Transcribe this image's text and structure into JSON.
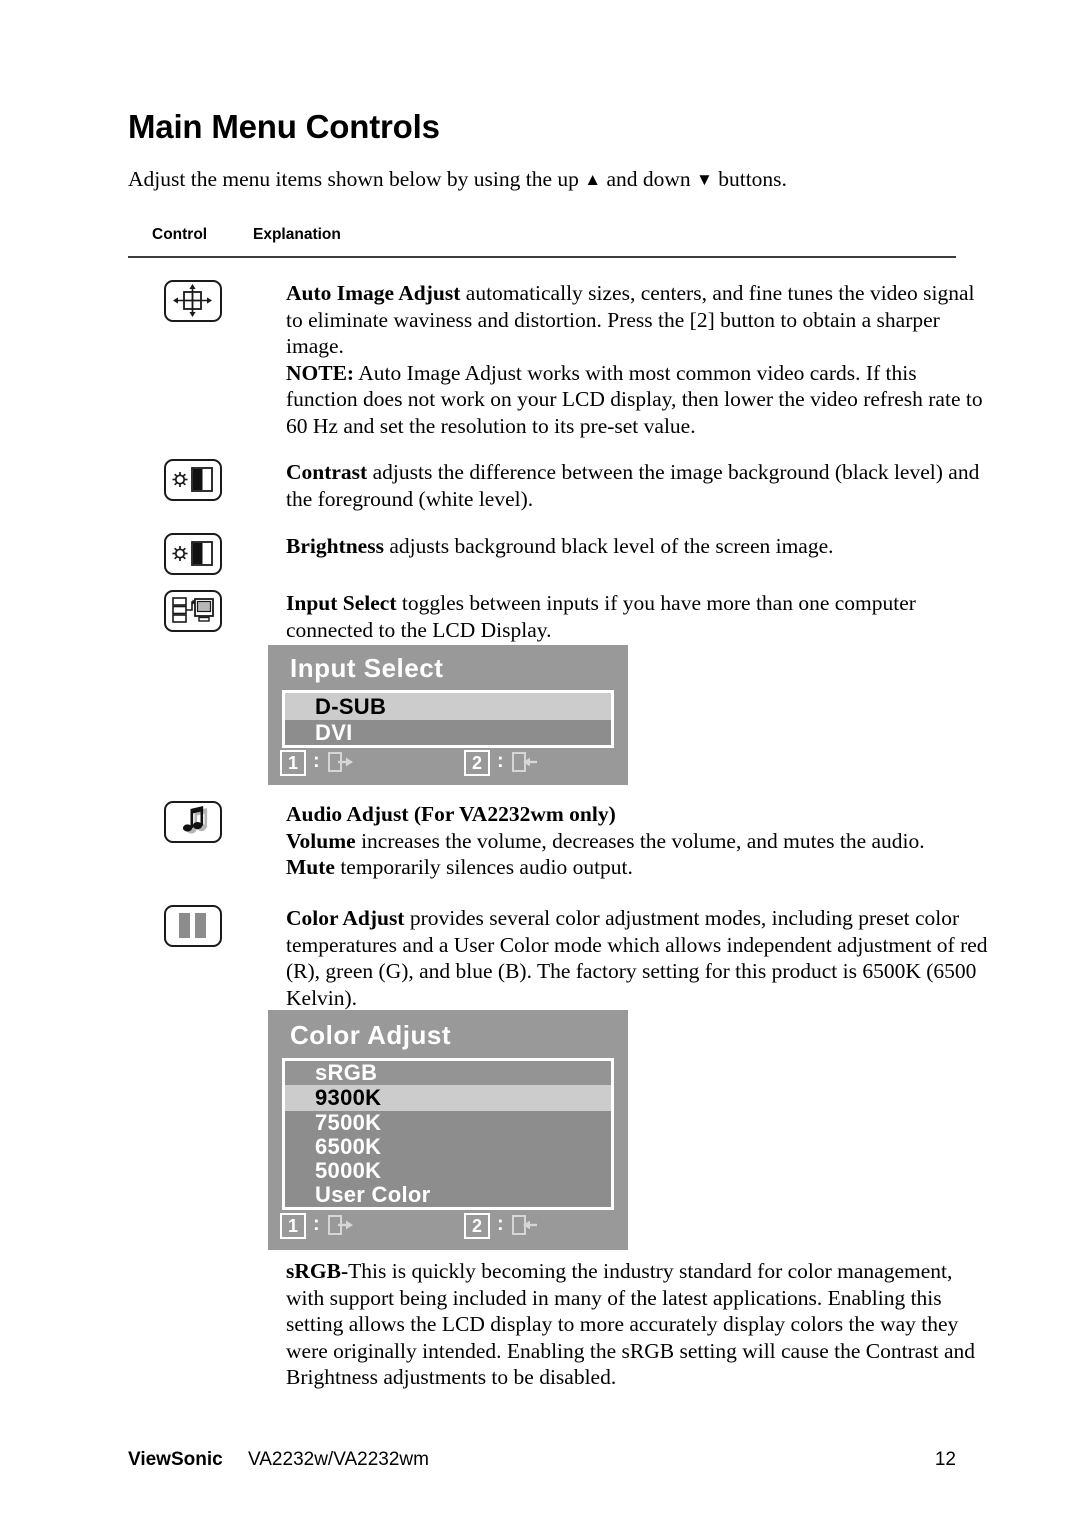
{
  "document": {
    "title": "Main Menu Controls",
    "intro_before": "Adjust the menu items shown below by using the up",
    "intro_middle": "and down",
    "intro_after": "buttons.",
    "up_arrow": "▲",
    "down_arrow": "▼"
  },
  "table_headers": {
    "control": "Control",
    "explanation": "Explanation"
  },
  "rows": {
    "auto_image_adjust": {
      "icon": "auto-image-adjust-icon",
      "term": "Auto Image Adjust",
      "body": " automatically sizes, centers, and fine tunes the video signal to eliminate waviness and distortion. Press the [2] button to obtain a sharper image.",
      "note_label": "NOTE:",
      "note_body": " Auto Image Adjust works with most common video cards. If this function does not work on your LCD display, then lower the video refresh rate to 60 Hz and set the resolution to its pre-set value."
    },
    "contrast": {
      "icon": "contrast-icon",
      "term": "Contrast",
      "body": " adjusts the difference between the image background  (black level) and the foreground (white level)."
    },
    "brightness": {
      "icon": "brightness-icon",
      "term": "Brightness",
      "body": " adjusts background black level of the screen image."
    },
    "input_select": {
      "icon": "input-select-icon",
      "term": "Input Select",
      "body": " toggles between inputs if you have more than one computer connected to the LCD Display."
    },
    "audio_adjust": {
      "icon": "audio-adjust-icon",
      "heading": "Audio Adjust (For VA2232wm only)",
      "volume_term": "Volume",
      "volume_body": " increases the volume, decreases the volume, and mutes the audio.",
      "mute_term": "Mute",
      "mute_body": " temporarily silences audio output."
    },
    "color_adjust": {
      "icon": "color-adjust-icon",
      "term": "Color Adjust",
      "body": " provides several color adjustment modes, including preset color temperatures and a User Color mode which allows independent adjustment of red (R), green (G), and blue (B). The factory setting for this product is 6500K (6500 Kelvin)."
    },
    "srgb": {
      "term": "sRGB-",
      "body": "This is quickly becoming the industry standard for color management, with support being included in many of the latest applications. Enabling this setting allows the LCD display to more accurately display colors the way they were originally intended. Enabling the sRGB setting will cause the Contrast and Brightness adjustments to be disabled."
    }
  },
  "osd_input_select": {
    "title": "Input Select",
    "items": [
      {
        "label": "D-SUB",
        "selected": true
      },
      {
        "label": "DVI",
        "selected": false
      }
    ],
    "hints": [
      {
        "key": "1",
        "separator": ":",
        "icon": "exit-right-icon"
      },
      {
        "key": "2",
        "separator": ":",
        "icon": "exit-left-icon"
      }
    ]
  },
  "osd_color_adjust": {
    "title": "Color Adjust",
    "items": [
      {
        "label": "sRGB",
        "selected": false
      },
      {
        "label": "9300K",
        "selected": true
      },
      {
        "label": "7500K",
        "selected": false
      },
      {
        "label": "6500K",
        "selected": false
      },
      {
        "label": "5000K",
        "selected": false
      },
      {
        "label": "User Color",
        "selected": false
      }
    ],
    "hints": [
      {
        "key": "1",
        "separator": ":",
        "icon": "exit-right-icon"
      },
      {
        "key": "2",
        "separator": ":",
        "icon": "exit-left-icon"
      }
    ]
  },
  "footer": {
    "brand": "ViewSonic",
    "model": "VA2232w/VA2232wm",
    "page_number": "12"
  },
  "colors": {
    "osd_background": "#999999",
    "osd_selected_row": "#cccccc",
    "osd_row": "#949494",
    "osd_border": "#ffffff",
    "text": "#000000"
  }
}
